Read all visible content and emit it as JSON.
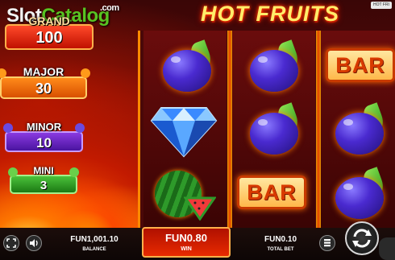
{
  "watermark": {
    "part1": "Slot",
    "part2": "Catalog",
    "tld": ".com"
  },
  "game_title": "HOT FRUITS",
  "corner_badge": "HOT FRI",
  "jackpots": [
    {
      "name": "GRAND",
      "value": "100"
    },
    {
      "name": "MAJOR",
      "value": "30"
    },
    {
      "name": "MINOR",
      "value": "10"
    },
    {
      "name": "MINI",
      "value": "3"
    }
  ],
  "reels": [
    {
      "symbols": [
        "plum",
        "diamond",
        "watermelon"
      ]
    },
    {
      "symbols": [
        "plum",
        "plum",
        "bar"
      ]
    },
    {
      "symbols": [
        "bar",
        "plum",
        "plum"
      ]
    }
  ],
  "bar_label": "BAR",
  "bottom": {
    "balance_value": "FUN1,001.10",
    "balance_label": "BALANCE",
    "win_value": "FUN0.80",
    "win_label": "WIN",
    "total_bet_value": "FUN0.10",
    "total_bet_label": "TOTAL BET"
  },
  "icons": {
    "fullscreen": "fullscreen-icon",
    "sound": "speaker-icon",
    "stack": "coin-stack-icon",
    "spin": "spin-arrows-icon"
  },
  "colors": {
    "accent": "#ff5a00",
    "grand": "#c01000",
    "major": "#d85000",
    "minor": "#4a14a0",
    "mini": "#1c7a14"
  }
}
